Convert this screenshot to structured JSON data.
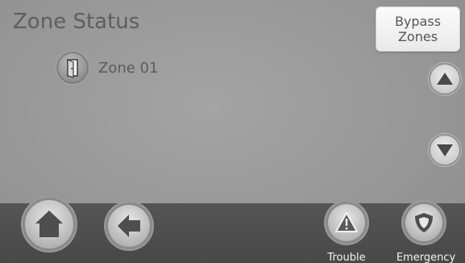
{
  "header": {
    "title": "Zone Status",
    "bypass_button": {
      "line1": "Bypass",
      "line2": "Zones"
    }
  },
  "zones": [
    {
      "label": "Zone 01",
      "icon": "door-open-icon"
    }
  ],
  "scroll": {
    "up_icon": "triangle-up-icon",
    "down_icon": "triangle-down-icon"
  },
  "bottom_bar": {
    "home_icon": "home-icon",
    "back_icon": "back-arrow-icon",
    "trouble_label": "Trouble",
    "trouble_icon": "warning-icon",
    "emergency_label": "Emergency",
    "emergency_icon": "shield-icon"
  },
  "colors": {
    "background": "#9a9a9a",
    "bottom_bar": "#4f4f4f",
    "title_text": "#5e5e5e"
  }
}
